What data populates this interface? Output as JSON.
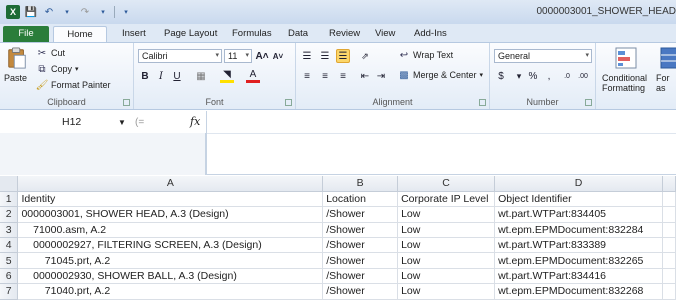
{
  "window": {
    "title": "0000003001_SHOWER_HEAD",
    "app_badge": "X"
  },
  "tabs": [
    "File",
    "Home",
    "Insert",
    "Page Layout",
    "Formulas",
    "Data",
    "Review",
    "View",
    "Add-Ins"
  ],
  "ribbon": {
    "clipboard": {
      "label": "Clipboard",
      "paste": "Paste",
      "cut": "Cut",
      "copy": "Copy",
      "format_painter": "Format Painter"
    },
    "font": {
      "label": "Font",
      "name": "Calibri",
      "size": "11"
    },
    "alignment": {
      "label": "Alignment",
      "wrap_text": "Wrap Text",
      "merge_center": "Merge & Center"
    },
    "number": {
      "label": "Number",
      "format": "General"
    },
    "styles": {
      "conditional_line1": "Conditional",
      "conditional_line2": "Formatting",
      "format_as_table_line1": "For",
      "format_as_table_line2": "as Ta"
    }
  },
  "formula_bar": {
    "name_box": "H12",
    "fx": "fx",
    "value": ""
  },
  "sheet": {
    "columns": [
      "A",
      "B",
      "C",
      "D"
    ],
    "rows": [
      {
        "num": "1",
        "cells": [
          "Identity",
          "Location",
          "Corporate IP Level",
          "Object Identifier"
        ]
      },
      {
        "num": "2",
        "cells": [
          "0000003001, SHOWER HEAD, A.3 (Design)",
          "/Shower",
          "Low",
          "wt.part.WTPart:834405"
        ]
      },
      {
        "num": "3",
        "cells": [
          "    71000.asm, A.2",
          "/Shower",
          "Low",
          "wt.epm.EPMDocument:832284"
        ]
      },
      {
        "num": "4",
        "cells": [
          "    0000002927, FILTERING SCREEN, A.3 (Design)",
          "/Shower",
          "Low",
          "wt.part.WTPart:833389"
        ]
      },
      {
        "num": "5",
        "cells": [
          "        71045.prt, A.2",
          "/Shower",
          "Low",
          "wt.epm.EPMDocument:832265"
        ]
      },
      {
        "num": "6",
        "cells": [
          "    0000002930, SHOWER BALL, A.3 (Design)",
          "/Shower",
          "Low",
          "wt.part.WTPart:834416"
        ]
      },
      {
        "num": "7",
        "cells": [
          "        71040.prt, A.2",
          "/Shower",
          "Low",
          "wt.epm.EPMDocument:832268"
        ]
      }
    ]
  },
  "colors": {
    "file_tab": "#2a7d3a",
    "ribbon_bg": "#e3ecf7",
    "highlight": "#fbd66a"
  }
}
